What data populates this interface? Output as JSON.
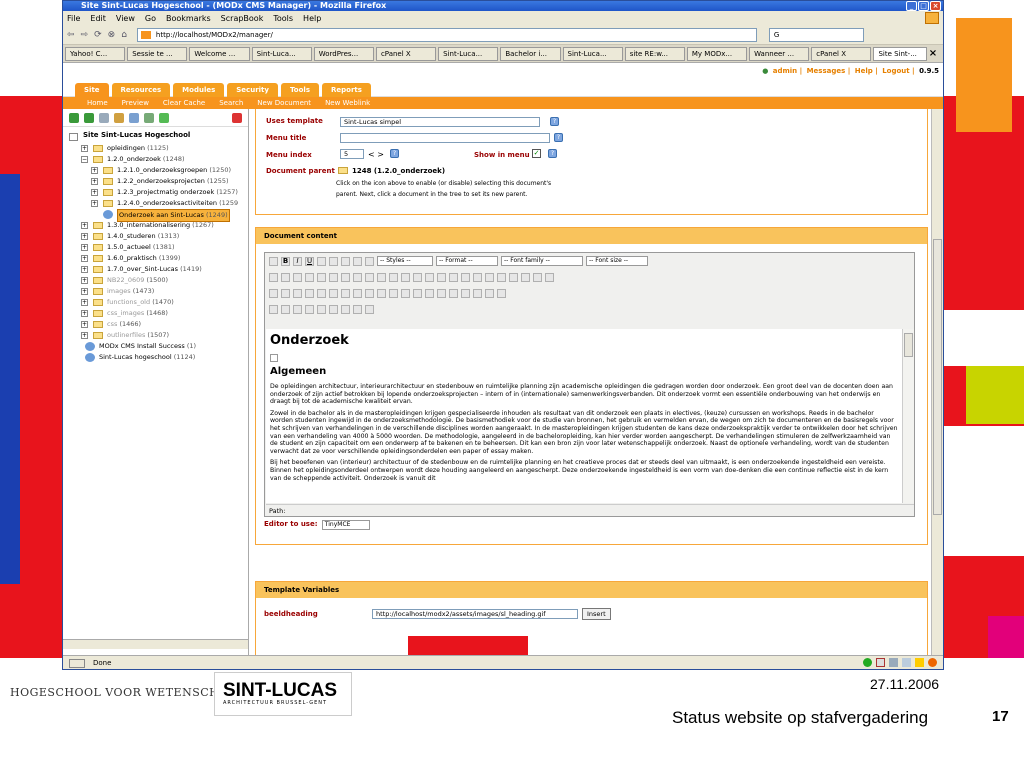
{
  "browser": {
    "title": "Site Sint-Lucas Hogeschool - (MODx CMS Manager) - Mozilla Firefox",
    "menu": [
      "File",
      "Edit",
      "View",
      "Go",
      "Bookmarks",
      "ScrapBook",
      "Tools",
      "Help"
    ],
    "url": "http://localhost/MODx2/manager/",
    "search_value": "G",
    "tabs": [
      "Yahoo! C...",
      "Sessie te ...",
      "Welcome ...",
      "Sint-Luca...",
      "WordPres...",
      "cPanel X",
      "Sint-Luca...",
      "Bachelor i...",
      "Sint-Luca...",
      "site RE:w...",
      "My MODx...",
      "Wanneer ...",
      "cPanel X",
      "Site Sint-..."
    ],
    "status": "Done"
  },
  "manager": {
    "user_links": [
      "admin",
      "Messages",
      "Help",
      "Logout",
      "0.9.5"
    ],
    "main_tabs": [
      "Site",
      "Resources",
      "Modules",
      "Security",
      "Tools",
      "Reports"
    ],
    "sub_tabs": [
      "Home",
      "Preview",
      "Clear Cache",
      "Search",
      "New Document",
      "New Weblink"
    ]
  },
  "tree": {
    "root": "Site Sint-Lucas Hogeschool",
    "nodes": [
      {
        "label": "opleidingen",
        "count": "(1125)"
      },
      {
        "label": "1.2.0_onderzoek",
        "count": "(1248)"
      },
      {
        "label": "1.2.1.0_onderzoeksgroepen",
        "count": "(1250)"
      },
      {
        "label": "1.2.2_onderzoeksprojecten",
        "count": "(1255)"
      },
      {
        "label": "1.2.3_projectmatig onderzoek",
        "count": "(1257)"
      },
      {
        "label": "1.2.4.0_onderzoeksactiviteiten",
        "count": "(1259"
      },
      {
        "label": "Onderzoek aan Sint-Lucas",
        "count": "(1249)"
      },
      {
        "label": "1.3.0_internationalisering",
        "count": "(1267)"
      },
      {
        "label": "1.4.0_studeren",
        "count": "(1313)"
      },
      {
        "label": "1.5.0_actueel",
        "count": "(1381)"
      },
      {
        "label": "1.6.0_praktisch",
        "count": "(1399)"
      },
      {
        "label": "1.7.0_over_Sint-Lucas",
        "count": "(1419)"
      },
      {
        "label": "NB22_0609",
        "count": "(1500)"
      },
      {
        "label": "images",
        "count": "(1473)"
      },
      {
        "label": "functions_old",
        "count": "(1470)"
      },
      {
        "label": "css_images",
        "count": "(1468)"
      },
      {
        "label": "css",
        "count": "(1466)"
      },
      {
        "label": "outlinerfiles",
        "count": "(1507)"
      },
      {
        "label": "MODx CMS Install Success",
        "count": "(1)"
      },
      {
        "label": "Sint-Lucas hogeschool",
        "count": "(1124)"
      }
    ]
  },
  "form": {
    "uses_template_label": "Uses template",
    "uses_template_value": "Sint-Lucas simpel",
    "menu_title_label": "Menu title",
    "menu_index_label": "Menu index",
    "menu_index_value": "5",
    "show_in_menu_label": "Show in menu",
    "document_parent_label": "Document parent",
    "parent_value": "1248 (1.2.0_onderzoek)",
    "parent_help": "Click on the icon above to enable (or disable) selecting this document's",
    "parent_help2": "parent. Next, click a document in the tree to set its new parent."
  },
  "editor": {
    "panel_title": "Document content",
    "styles": "-- Styles --",
    "format": "-- Format --",
    "font_family": "-- Font family --",
    "font_size": "-- Font size --",
    "heading": "Onderzoek",
    "subheading": "Algemeen",
    "p1": "De opleidingen architectuur, interieurarchitectuur en stedenbouw en ruimtelijke planning zijn academische opleidingen die gedragen worden door onderzoek. Een groot deel van de docenten doen aan onderzoek of zijn actief betrokken bij lopende onderzoeksprojecten – intern of in (internationale) samenwerkingsverbanden. Dit onderzoek vormt een essentiële onderbouwing van het onderwijs en draagt bij tot de academische kwaliteit ervan.",
    "p2": "Zowel in de bachelor als in de masteropleidingen krijgen gespecialiseerde inhouden als resultaat van dit onderzoek een plaats in electives, (keuze) cursussen en workshops. Reeds in de bachelor worden studenten ingewijd in de onderzoeksmethodologie. De basismethodiek voor de studie van bronnen, het gebruik en vermelden ervan, de wegen om zich te documenteren en de basisregels voor het schrijven van verhandelingen in de verschillende disciplines worden aangeraakt. In de masteropleidingen krijgen studenten de kans deze onderzoekspraktijk verder te ontwikkelen door het schrijven van een verhandeling van 4000 à 5000 woorden. De methodologie, aangeleerd in de bacheloropleiding, kan hier verder worden aangescherpt. De verhandelingen stimuleren de zelfwerkzaamheid van de student en zijn capaciteit om een onderwerp af te bakenen en te beheersen. Dit kan een bron zijn voor later wetenschappelijk onderzoek. Naast de optionele verhandeling, wordt van de studenten verwacht dat ze voor verschillende opleidingsonderdelen een paper of essay maken.",
    "p3": "Bij het beoefenen van (interieur) architectuur of de stedenbouw en de ruimtelijke planning en het creatieve proces dat er steeds deel van uitmaakt, is een onderzoekende ingesteldheid een vereiste. Binnen het opleidingsonderdeel ontwerpen wordt deze houding aangeleerd en aangescherpt. Deze onderzoekende ingesteldheid is een vorm van doe-denken die een continue reflectie eist in de kern van de scheppende activiteit. Onderzoek is vanuit dit",
    "path_label": "Path:",
    "editor_to_use_label": "Editor to use:",
    "editor_value": "TinyMCE"
  },
  "tv": {
    "panel_title": "Template Variables",
    "field_label": "beeldheading",
    "field_value": "http://localhost/modx2/assets/images/sl_heading.gif",
    "insert_label": "Insert"
  },
  "slide": {
    "logo_left": "HOGESCHOOL VOOR WETENSCHAP & KUNST",
    "logo_big": "SINT-LUCAS",
    "logo_small": "ARCHITECTUUR BRUSSEL-GENT",
    "date": "27.11.2006",
    "title": "Status website op stafvergadering",
    "number": "17"
  },
  "colors": {
    "accent": "#f7941d",
    "brand_red": "#e8141c",
    "blue": "#1b3fb0",
    "lime": "#c8d400"
  }
}
